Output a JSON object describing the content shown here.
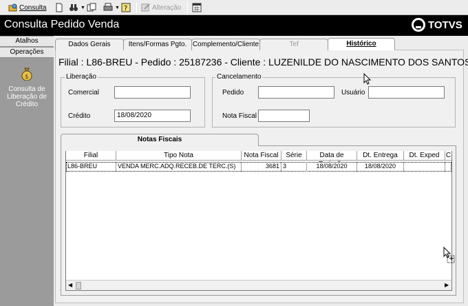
{
  "toolbar": {
    "consulta_label": "Consulta",
    "alteracao_label": "Alteração"
  },
  "header": {
    "title": "Consulta Pedido Venda",
    "logo_text": "TOTVS"
  },
  "sidebar": {
    "tabs": [
      "Atalhos",
      "Operações"
    ],
    "item_label": "Consulta de Liberação de Crédito"
  },
  "tabs": [
    {
      "label": "Dados Gerais",
      "state": "normal"
    },
    {
      "label": "Itens/Formas Pgto.",
      "state": "normal"
    },
    {
      "label": "Complemento/Cliente",
      "state": "normal"
    },
    {
      "label": "Tef",
      "state": "disabled"
    },
    {
      "label": "Histórico",
      "state": "active"
    }
  ],
  "info": {
    "line": "Filial : L86-BREU - Pedido : 25187236 - Cliente : LUZENILDE DO NASCIMENTO DOS SANTOS"
  },
  "liberacao": {
    "title": "Liberação",
    "comercial_label": "Comercial",
    "comercial_value": "",
    "credito_label": "Crédito",
    "credito_value": "18/08/2020"
  },
  "cancelamento": {
    "title": "Cancelamento",
    "pedido_label": "Pedido",
    "pedido_value": "",
    "usuario_label": "Usuário",
    "usuario_value": "",
    "nota_label": "Nota Fiscal",
    "nota_value": ""
  },
  "notas": {
    "tab_label": "Notas Fiscais",
    "columns": [
      "Filial",
      "Tipo Nota",
      "Nota Fiscal",
      "Série",
      "Data de Emissão",
      "Dt. Entrega",
      "Dt. Exped",
      "C"
    ],
    "rows": [
      [
        "L86-BREU",
        "VENDA MERC.ADQ.RECEB.DE TERC.(S)",
        "3681",
        "3",
        "18/08/2020",
        "18/08/2020",
        "",
        ""
      ]
    ]
  },
  "colors": {
    "header_bg": "#000000",
    "sidebar_bg": "#9b9b9b"
  }
}
